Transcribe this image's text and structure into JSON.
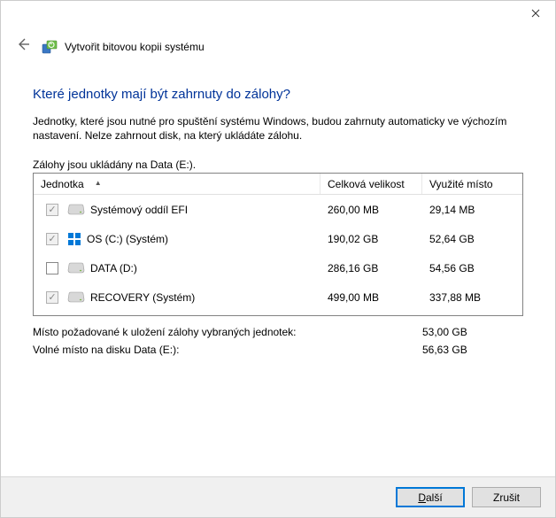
{
  "window": {
    "title": "Vytvořit bitovou kopii systému"
  },
  "heading": "Které jednotky mají být zahrnuty do zálohy?",
  "description": "Jednotky, které jsou nutné pro spuštění systému Windows, budou zahrnuty automaticky ve výchozím nastavení. Nelze zahrnout disk, na který ukládáte zálohu.",
  "save_line": "Zálohy jsou ukládány na Data (E:).",
  "columns": {
    "drive": "Jednotka",
    "size": "Celková velikost",
    "used": "Využité místo"
  },
  "rows": [
    {
      "checked": true,
      "mandatory": true,
      "icon": "drive",
      "label": "Systémový oddíl EFI",
      "size": "260,00 MB",
      "used": "29,14 MB"
    },
    {
      "checked": true,
      "mandatory": true,
      "icon": "os",
      "label": "OS (C:) (Systém)",
      "size": "190,02 GB",
      "used": "52,64 GB"
    },
    {
      "checked": false,
      "mandatory": false,
      "icon": "drive",
      "label": "DATA (D:)",
      "size": "286,16 GB",
      "used": "54,56 GB"
    },
    {
      "checked": true,
      "mandatory": true,
      "icon": "drive",
      "label": "RECOVERY (Systém)",
      "size": "499,00 MB",
      "used": "337,88 MB"
    }
  ],
  "summary": {
    "required_label": "Místo požadované k uložení zálohy vybraných jednotek:",
    "required_value": "53,00 GB",
    "free_label": "Volné místo na disku Data (E:):",
    "free_value": "56,63 GB"
  },
  "buttons": {
    "next_prefix": "D",
    "next_rest": "alší",
    "cancel": "Zrušit"
  }
}
